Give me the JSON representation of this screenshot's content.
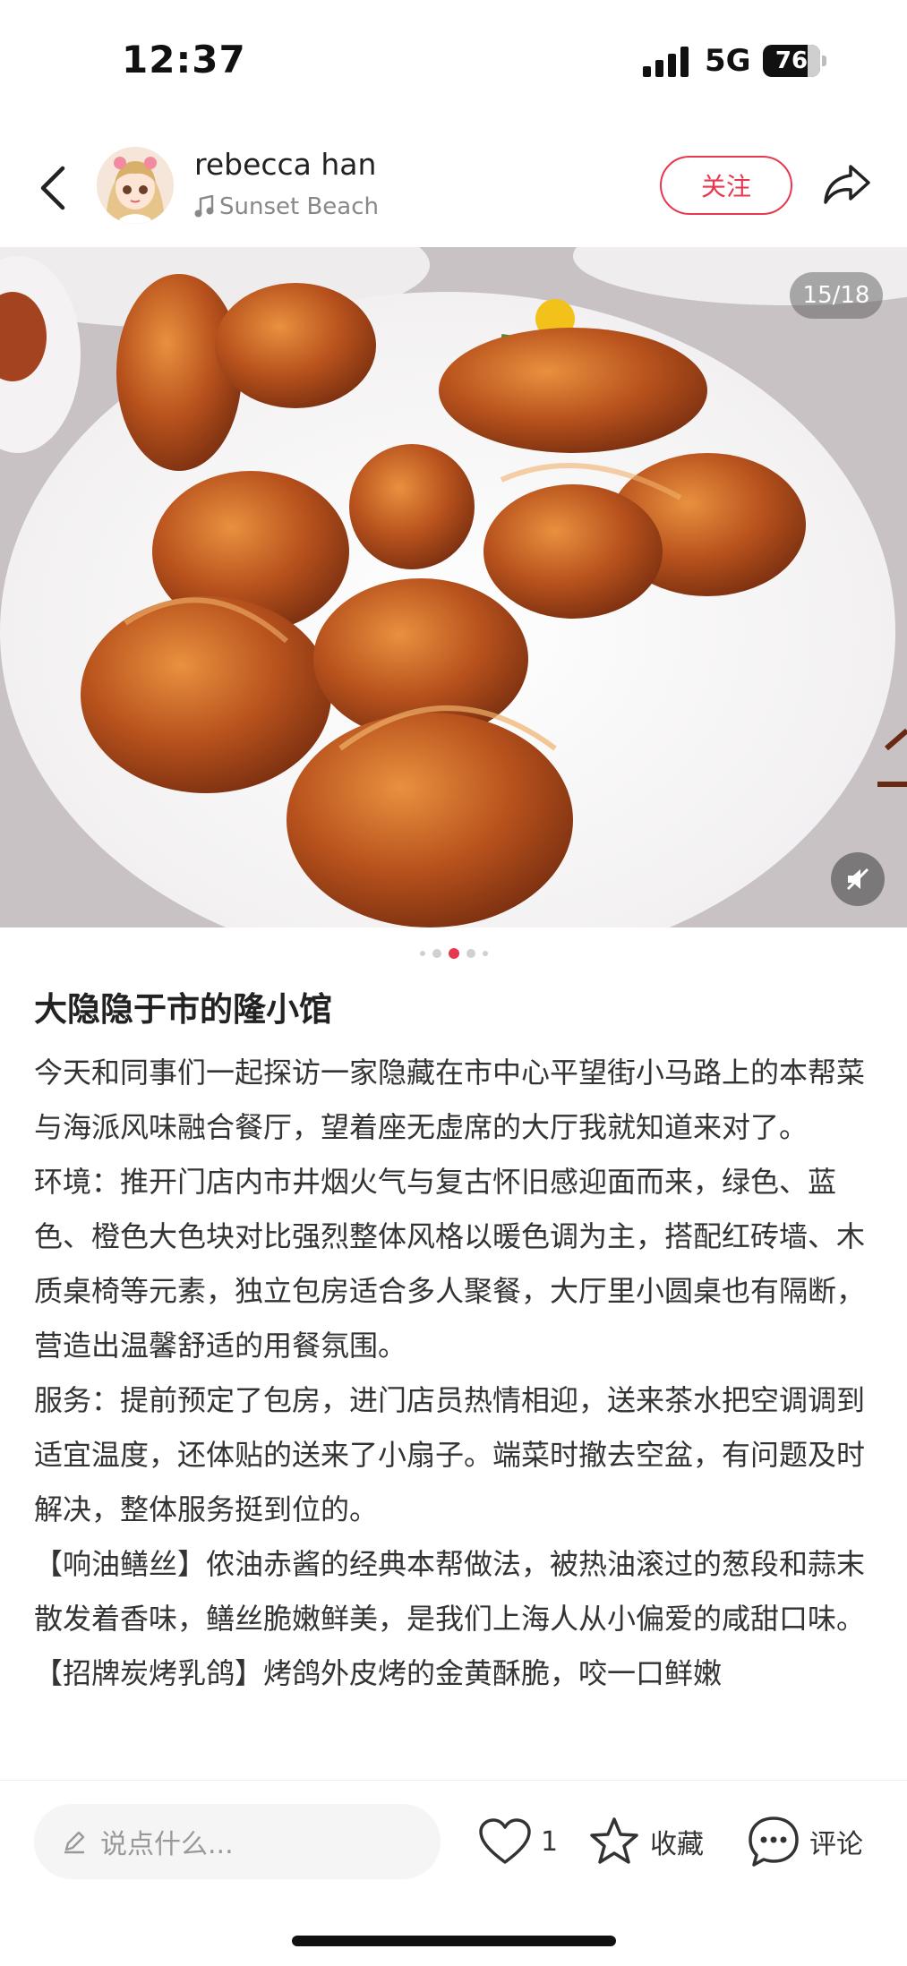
{
  "status_bar": {
    "time": "12:37",
    "network": "5G",
    "battery": "76"
  },
  "header": {
    "username": "rebecca han",
    "music": "Sunset Beach",
    "follow_label": "关注"
  },
  "photo": {
    "counter": "15/18",
    "current_index": 15,
    "total": 18
  },
  "pagination": {
    "dot_count": 5,
    "active_dot": 3
  },
  "post": {
    "title": "大隐隐于市的隆小馆",
    "paragraphs": [
      "今天和同事们一起探访一家隐藏在市中心平望街小马路上的本帮菜与海派风味融合餐厅，望着座无虚席的大厅我就知道来对了。",
      "环境：推开门店内市井烟火气与复古怀旧感迎面而来，绿色、蓝色、橙色大色块对比强烈整体风格以暖色调为主，搭配红砖墙、木质桌椅等元素，独立包房适合多人聚餐，大厅里小圆桌也有隔断，营造出温馨舒适的用餐氛围。",
      "服务：提前预定了包房，进门店员热情相迎，送来茶水把空调调到适宜温度，还体贴的送来了小扇子。端菜时撤去空盆，有问题及时解决，整体服务挺到位的。",
      "【响油鳝丝】侬油赤酱的经典本帮做法，被热油滚过的葱段和蒜末散发着香味，鳝丝脆嫩鲜美，是我们上海人从小偏爱的咸甜口味。",
      "【招牌炭烤乳鸽】烤鸽外皮烤的金黄酥脆，咬一口鲜嫩"
    ]
  },
  "bottom_bar": {
    "comment_placeholder": "说点什么...",
    "like_count": "1",
    "collect_label": "收藏",
    "comment_label": "评论"
  },
  "colors": {
    "accent": "#e8384f",
    "text": "#333333",
    "input_bg": "#f5f5f5"
  }
}
